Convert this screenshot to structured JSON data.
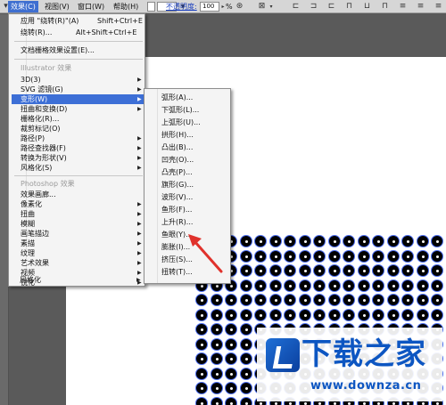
{
  "menubar": {
    "effect": "效果(C)",
    "view": "视图(V)",
    "window": "窗口(W)",
    "help": "帮助(H)",
    "opacity_label": "不透明度:",
    "opacity_value": "100",
    "opacity_unit": "%"
  },
  "menu": {
    "apply_last": "应用 \"绕转(R)\"(A)",
    "apply_last_shortcut": "Shift+Ctrl+E",
    "last_effect": "绕转(R)...",
    "last_effect_shortcut": "Alt+Shift+Ctrl+E",
    "raster_settings": "文档栅格效果设置(E)...",
    "illustrator_header": "Illustrator 效果",
    "illustrator_items": [
      "3D(3)",
      "SVG 滤镜(G)",
      "变形(W)",
      "扭曲和变换(D)",
      "栅格化(R)...",
      "裁剪标记(O)",
      "路径(P)",
      "路径查找器(F)",
      "转换为形状(V)",
      "风格化(S)"
    ],
    "photoshop_header": "Photoshop 效果",
    "photoshop_items": [
      "效果画廊...",
      "像素化",
      "扭曲",
      "模糊",
      "画笔描边",
      "素描",
      "纹理",
      "艺术效果",
      "视频",
      "锐化",
      "风格化"
    ]
  },
  "submenu": {
    "items": [
      "弧形(A)...",
      "下弧形(L)...",
      "上弧形(U)...",
      "拱形(H)...",
      "凸出(B)...",
      "凹壳(O)...",
      "凸壳(P)...",
      "旗形(G)...",
      "波形(V)...",
      "鱼形(F)...",
      "上升(R)...",
      "鱼眼(Y)...",
      "膨胀(I)...",
      "挤压(S)...",
      "扭转(T)..."
    ]
  },
  "watermark": {
    "text": "下载之家",
    "url": "www.downza.cn"
  },
  "colors": {
    "highlight": "#3d6fd6",
    "annotation_arrow": "#e0322c",
    "dot_outline": "#4b6cf0",
    "watermark_blue": "#0d56c2"
  }
}
